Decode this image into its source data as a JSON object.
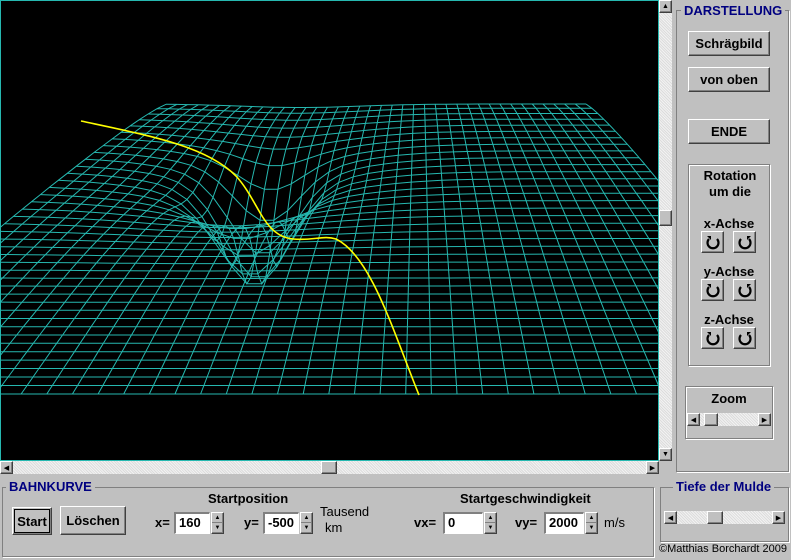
{
  "darstellung": {
    "title": "DARSTELLUNG",
    "schraegbild_label": "Schrägbild",
    "von_oben_label": "von oben",
    "ende_label": "ENDE",
    "rotation_title": "Rotation um die",
    "x_achse": "x-Achse",
    "y_achse": "y-Achse",
    "z_achse": "z-Achse",
    "zoom_label": "Zoom",
    "zoom_level": 0.1
  },
  "bahnkurve": {
    "title": "BAHNKURVE",
    "start_label": "Start",
    "loeschen_label": "Löschen",
    "startposition_label": "Startposition",
    "x_label": "x=",
    "x_value": "160",
    "y_label": "y=",
    "y_value": "-500",
    "unit_tausend": "Tausend",
    "unit_km": "km",
    "startgeschwindigkeit_label": "Startgeschwindigkeit",
    "vx_label": "vx=",
    "vx_value": "0",
    "vy_label": "vy=",
    "vy_value": "2000",
    "vy_unit": "m/s"
  },
  "tiefe": {
    "title": "Tiefe der Mulde",
    "level": 0.38
  },
  "copyright": "©Matthias Borchardt 2009",
  "colors": {
    "mesh": "#26b8b0",
    "trajectory": "#ffff00",
    "viewport_bg": "#000000",
    "group_title": "#000080"
  }
}
